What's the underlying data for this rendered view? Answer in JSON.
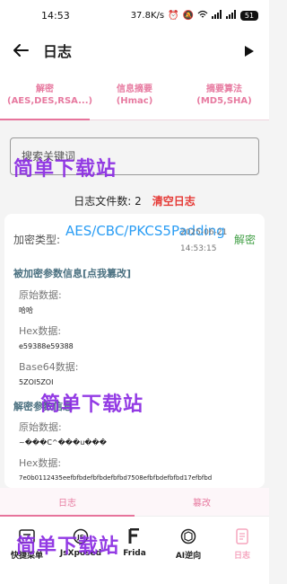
{
  "status_bar": {
    "time": "14:53",
    "network_speed": "37.8K/s",
    "battery": "51"
  },
  "app_bar": {
    "title": "日志"
  },
  "tabs": [
    {
      "label": "解密(AES,DES,RSA...)",
      "active": true
    },
    {
      "label": "信息摘要(Hmac)",
      "active": false
    },
    {
      "label": "摘要算法(MD5,SHA)",
      "active": false
    }
  ],
  "search": {
    "placeholder": "搜索关键词"
  },
  "log_count": {
    "label": "日志文件数: 2",
    "clear_label": "清空日志"
  },
  "log_entry": {
    "type_label": "加密类型:",
    "algorithm": "AES/CBC/PKCS5Padding",
    "date": "2025-06-21",
    "time": "14:53:15",
    "operation": "解密",
    "encrypted_params_title": "被加密参数信息[点我篡改]",
    "decrypted_params_title": "解密参数信息",
    "encrypted": {
      "raw_label": "原始数据:",
      "raw_value": "哈哈",
      "hex_label": "Hex数据:",
      "hex_value": "e59388e59388",
      "base64_label": "Base64数据:",
      "base64_value": "5ZOI5ZOI"
    },
    "decrypted": {
      "raw_label": "原始数据:",
      "raw_value": "~���C^���u���",
      "hex_label": "Hex数据:",
      "hex_value": "7e0b0112435eefbfbdefbfbdefbfbd7508efbfbdefbfbd17efbfbd"
    }
  },
  "segment_tabs": [
    {
      "label": "日志",
      "active": true
    },
    {
      "label": "篡改",
      "active": false
    }
  ],
  "bottom_nav": [
    {
      "label": "快捷菜单",
      "icon": "menu-icon",
      "active": false
    },
    {
      "label": "JsXposed",
      "icon": "jsxposed-icon",
      "active": false
    },
    {
      "label": "Frida",
      "icon": "frida-icon",
      "active": false
    },
    {
      "label": "AI逆向",
      "icon": "ai-icon",
      "active": false
    },
    {
      "label": "日志",
      "icon": "log-icon",
      "active": true
    }
  ],
  "watermark": "简单下载站",
  "colors": {
    "accent_pink": "#e7749c",
    "algo_blue": "#2a9df4",
    "decrypt_green": "#43a047",
    "clear_red": "#e53935",
    "watermark_purple": "#8a2be2"
  }
}
